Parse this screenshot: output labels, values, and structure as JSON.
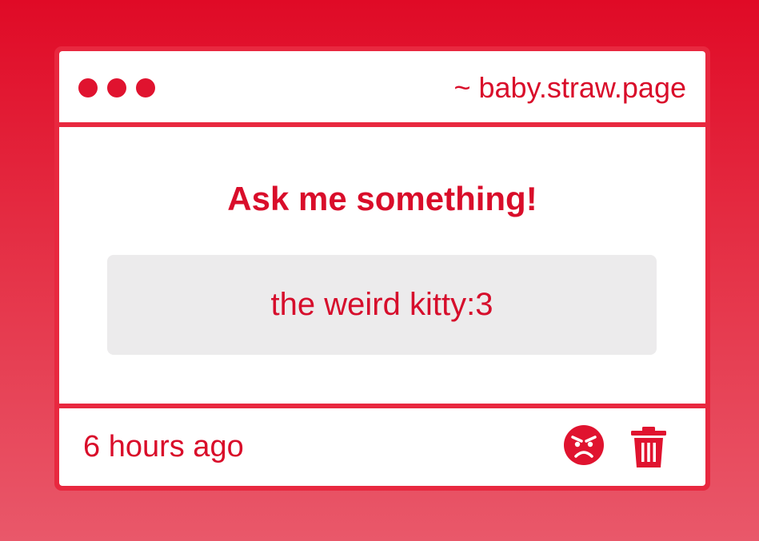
{
  "window": {
    "url": "~ baby.straw.page"
  },
  "question": {
    "heading": "Ask me something!",
    "text": "the weird kitty:3"
  },
  "footer": {
    "timestamp": "6 hours ago"
  },
  "icons": {
    "dots": "window-control-dots",
    "react": "angry-face-icon",
    "delete": "trash-icon"
  },
  "colors": {
    "accent": "#e0132f",
    "question_bg": "#ecebec",
    "background_top": "#e00a26",
    "background_bottom": "#e9586a"
  }
}
